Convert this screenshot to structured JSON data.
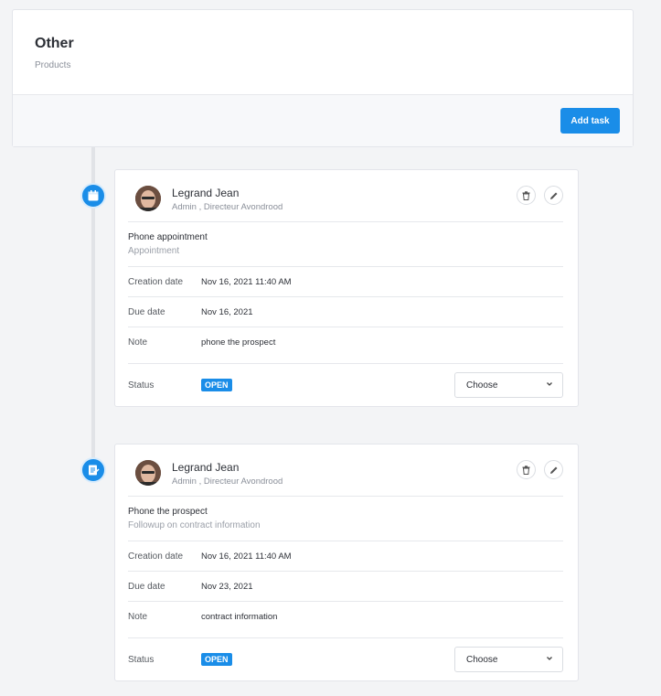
{
  "header": {
    "title": "Other",
    "subtitle": "Products",
    "add_task_label": "Add task"
  },
  "labels": {
    "creation_date": "Creation date",
    "due_date": "Due date",
    "note": "Note",
    "status": "Status"
  },
  "tasks": [
    {
      "icon": "calendar-icon",
      "user_name": "Legrand Jean",
      "user_role": "Admin , Directeur Avondrood",
      "title": "Phone appointment",
      "type": "Appointment",
      "creation_date": "Nov 16, 2021 11:40 AM",
      "due_date": "Nov 16, 2021",
      "note": "phone the prospect",
      "status": "OPEN",
      "select_value": "Choose"
    },
    {
      "icon": "document-icon",
      "user_name": "Legrand Jean",
      "user_role": "Admin , Directeur Avondrood",
      "title": "Phone the prospect",
      "type": "Followup on contract information",
      "creation_date": "Nov 16, 2021 11:40 AM",
      "due_date": "Nov 23, 2021",
      "note": "contract information",
      "status": "OPEN",
      "select_value": "Choose"
    }
  ],
  "colors": {
    "accent": "#1a8de8",
    "background": "#f3f4f6"
  }
}
